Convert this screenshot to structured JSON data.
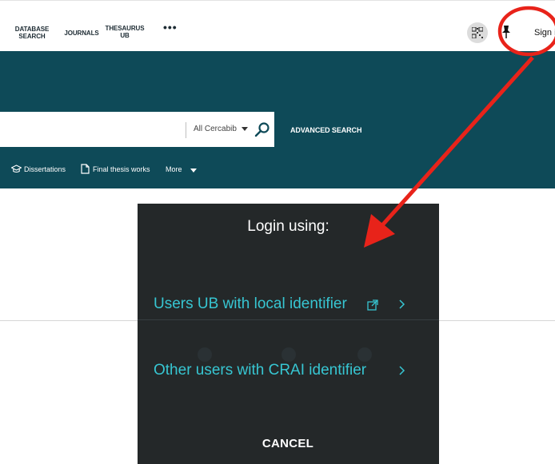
{
  "topbar": {
    "nav": {
      "database_search": "DATABASE SEARCH",
      "journals": "JOURNALS",
      "thesaurus_ub": "THESAURUS UB",
      "more": "•••"
    },
    "sign_in": "Sign in"
  },
  "search": {
    "scope": "All Cercabib",
    "advanced_search": "ADVANCED SEARCH"
  },
  "resources": {
    "dissertations": "Dissertations",
    "final_thesis_works": "Final thesis works",
    "more": "More"
  },
  "dialog": {
    "title": "Login using:",
    "option_ub": "Users UB with local identifier",
    "option_crai": "Other users with CRAI identifier",
    "cancel": "CANCEL"
  },
  "icons": {
    "qr": "qr-code-icon",
    "pin": "pin-icon",
    "search": "search-icon",
    "graduation": "graduation-cap-icon",
    "document": "document-icon",
    "external": "external-link-icon",
    "chevron": "chevron-right-icon"
  },
  "colors": {
    "hero": "#0e4a58",
    "dialog_bg": "#181c1e",
    "option_text": "#37c6d2",
    "annotation": "#e8231a"
  }
}
